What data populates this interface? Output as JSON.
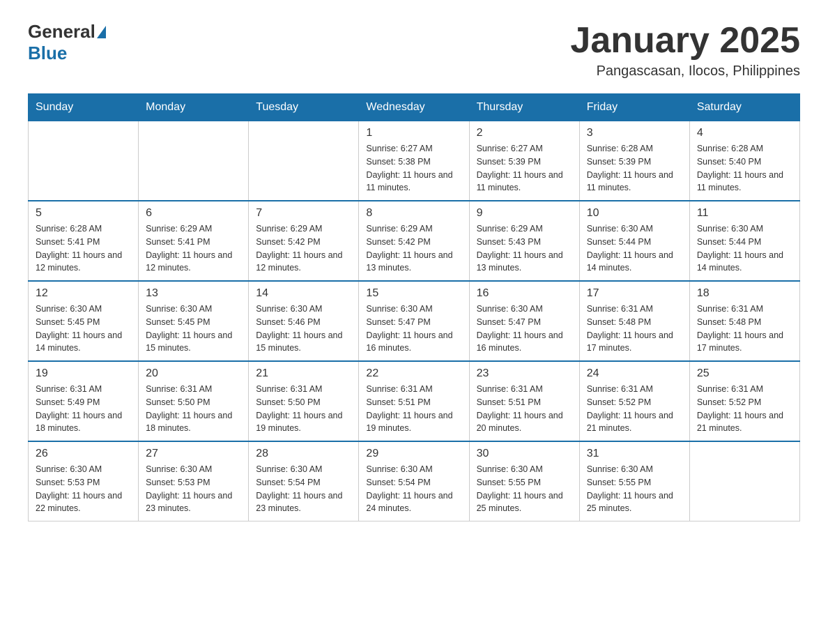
{
  "header": {
    "logo": {
      "text_general": "General",
      "text_blue": "Blue",
      "alt": "GeneralBlue logo"
    },
    "title": "January 2025",
    "location": "Pangascasan, Ilocos, Philippines"
  },
  "calendar": {
    "days_of_week": [
      "Sunday",
      "Monday",
      "Tuesday",
      "Wednesday",
      "Thursday",
      "Friday",
      "Saturday"
    ],
    "weeks": [
      [
        {
          "day": "",
          "sunrise": "",
          "sunset": "",
          "daylight": ""
        },
        {
          "day": "",
          "sunrise": "",
          "sunset": "",
          "daylight": ""
        },
        {
          "day": "",
          "sunrise": "",
          "sunset": "",
          "daylight": ""
        },
        {
          "day": "1",
          "sunrise": "Sunrise: 6:27 AM",
          "sunset": "Sunset: 5:38 PM",
          "daylight": "Daylight: 11 hours and 11 minutes."
        },
        {
          "day": "2",
          "sunrise": "Sunrise: 6:27 AM",
          "sunset": "Sunset: 5:39 PM",
          "daylight": "Daylight: 11 hours and 11 minutes."
        },
        {
          "day": "3",
          "sunrise": "Sunrise: 6:28 AM",
          "sunset": "Sunset: 5:39 PM",
          "daylight": "Daylight: 11 hours and 11 minutes."
        },
        {
          "day": "4",
          "sunrise": "Sunrise: 6:28 AM",
          "sunset": "Sunset: 5:40 PM",
          "daylight": "Daylight: 11 hours and 11 minutes."
        }
      ],
      [
        {
          "day": "5",
          "sunrise": "Sunrise: 6:28 AM",
          "sunset": "Sunset: 5:41 PM",
          "daylight": "Daylight: 11 hours and 12 minutes."
        },
        {
          "day": "6",
          "sunrise": "Sunrise: 6:29 AM",
          "sunset": "Sunset: 5:41 PM",
          "daylight": "Daylight: 11 hours and 12 minutes."
        },
        {
          "day": "7",
          "sunrise": "Sunrise: 6:29 AM",
          "sunset": "Sunset: 5:42 PM",
          "daylight": "Daylight: 11 hours and 12 minutes."
        },
        {
          "day": "8",
          "sunrise": "Sunrise: 6:29 AM",
          "sunset": "Sunset: 5:42 PM",
          "daylight": "Daylight: 11 hours and 13 minutes."
        },
        {
          "day": "9",
          "sunrise": "Sunrise: 6:29 AM",
          "sunset": "Sunset: 5:43 PM",
          "daylight": "Daylight: 11 hours and 13 minutes."
        },
        {
          "day": "10",
          "sunrise": "Sunrise: 6:30 AM",
          "sunset": "Sunset: 5:44 PM",
          "daylight": "Daylight: 11 hours and 14 minutes."
        },
        {
          "day": "11",
          "sunrise": "Sunrise: 6:30 AM",
          "sunset": "Sunset: 5:44 PM",
          "daylight": "Daylight: 11 hours and 14 minutes."
        }
      ],
      [
        {
          "day": "12",
          "sunrise": "Sunrise: 6:30 AM",
          "sunset": "Sunset: 5:45 PM",
          "daylight": "Daylight: 11 hours and 14 minutes."
        },
        {
          "day": "13",
          "sunrise": "Sunrise: 6:30 AM",
          "sunset": "Sunset: 5:45 PM",
          "daylight": "Daylight: 11 hours and 15 minutes."
        },
        {
          "day": "14",
          "sunrise": "Sunrise: 6:30 AM",
          "sunset": "Sunset: 5:46 PM",
          "daylight": "Daylight: 11 hours and 15 minutes."
        },
        {
          "day": "15",
          "sunrise": "Sunrise: 6:30 AM",
          "sunset": "Sunset: 5:47 PM",
          "daylight": "Daylight: 11 hours and 16 minutes."
        },
        {
          "day": "16",
          "sunrise": "Sunrise: 6:30 AM",
          "sunset": "Sunset: 5:47 PM",
          "daylight": "Daylight: 11 hours and 16 minutes."
        },
        {
          "day": "17",
          "sunrise": "Sunrise: 6:31 AM",
          "sunset": "Sunset: 5:48 PM",
          "daylight": "Daylight: 11 hours and 17 minutes."
        },
        {
          "day": "18",
          "sunrise": "Sunrise: 6:31 AM",
          "sunset": "Sunset: 5:48 PM",
          "daylight": "Daylight: 11 hours and 17 minutes."
        }
      ],
      [
        {
          "day": "19",
          "sunrise": "Sunrise: 6:31 AM",
          "sunset": "Sunset: 5:49 PM",
          "daylight": "Daylight: 11 hours and 18 minutes."
        },
        {
          "day": "20",
          "sunrise": "Sunrise: 6:31 AM",
          "sunset": "Sunset: 5:50 PM",
          "daylight": "Daylight: 11 hours and 18 minutes."
        },
        {
          "day": "21",
          "sunrise": "Sunrise: 6:31 AM",
          "sunset": "Sunset: 5:50 PM",
          "daylight": "Daylight: 11 hours and 19 minutes."
        },
        {
          "day": "22",
          "sunrise": "Sunrise: 6:31 AM",
          "sunset": "Sunset: 5:51 PM",
          "daylight": "Daylight: 11 hours and 19 minutes."
        },
        {
          "day": "23",
          "sunrise": "Sunrise: 6:31 AM",
          "sunset": "Sunset: 5:51 PM",
          "daylight": "Daylight: 11 hours and 20 minutes."
        },
        {
          "day": "24",
          "sunrise": "Sunrise: 6:31 AM",
          "sunset": "Sunset: 5:52 PM",
          "daylight": "Daylight: 11 hours and 21 minutes."
        },
        {
          "day": "25",
          "sunrise": "Sunrise: 6:31 AM",
          "sunset": "Sunset: 5:52 PM",
          "daylight": "Daylight: 11 hours and 21 minutes."
        }
      ],
      [
        {
          "day": "26",
          "sunrise": "Sunrise: 6:30 AM",
          "sunset": "Sunset: 5:53 PM",
          "daylight": "Daylight: 11 hours and 22 minutes."
        },
        {
          "day": "27",
          "sunrise": "Sunrise: 6:30 AM",
          "sunset": "Sunset: 5:53 PM",
          "daylight": "Daylight: 11 hours and 23 minutes."
        },
        {
          "day": "28",
          "sunrise": "Sunrise: 6:30 AM",
          "sunset": "Sunset: 5:54 PM",
          "daylight": "Daylight: 11 hours and 23 minutes."
        },
        {
          "day": "29",
          "sunrise": "Sunrise: 6:30 AM",
          "sunset": "Sunset: 5:54 PM",
          "daylight": "Daylight: 11 hours and 24 minutes."
        },
        {
          "day": "30",
          "sunrise": "Sunrise: 6:30 AM",
          "sunset": "Sunset: 5:55 PM",
          "daylight": "Daylight: 11 hours and 25 minutes."
        },
        {
          "day": "31",
          "sunrise": "Sunrise: 6:30 AM",
          "sunset": "Sunset: 5:55 PM",
          "daylight": "Daylight: 11 hours and 25 minutes."
        },
        {
          "day": "",
          "sunrise": "",
          "sunset": "",
          "daylight": ""
        }
      ]
    ]
  }
}
